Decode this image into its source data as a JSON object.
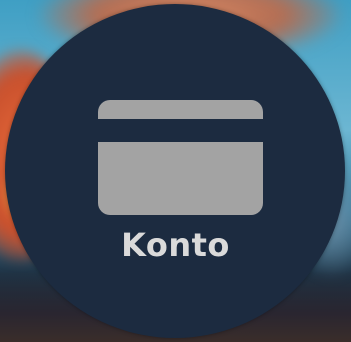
{
  "account_tile": {
    "label": "Konto",
    "icon": "credit-card-icon",
    "colors": {
      "circle": "#1c2b40",
      "icon": "#a3a3a3",
      "label": "#dadada"
    }
  }
}
